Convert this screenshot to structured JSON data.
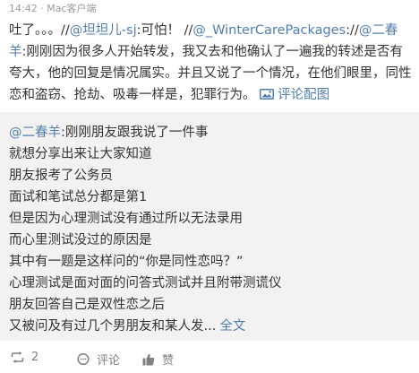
{
  "post": {
    "time": "14:42",
    "separator": " · ",
    "source": "Mac客户端",
    "text_start": "吐了。。。//",
    "mention1": "@坦坦儿-sj",
    "text_mid1": ":可怕！ //",
    "mention2": "@_WinterCarePackages",
    "text_mid2": "://",
    "mention3": "@二春羊",
    "text_mid3": ":刚刚因为很多人开始转发，我又去和他确认了一遍我的转述是否有夸大，他的回复是情况属实。并且又说了一个情况，在他们眼里，同性恋和盗窃、抢劫、吸毒一样是，犯罪行为。",
    "pic_link_label": "评论配图",
    "pic_icon": "image-icon"
  },
  "repost": {
    "author": "@二春羊",
    "first_line_rest": ":刚刚朋友跟我说了一件事",
    "lines": [
      "就想分享出来让大家知道",
      "朋友报考了公务员",
      "面试和笔试总分都是第1",
      "但是因为心理测试没有通过所以无法录用",
      "而心里测试没过的原因是",
      "其中有一题是这样问的“你是同性恋吗？”",
      "心理测试是面对面的问答式测试并且附带测谎仪",
      "朋友回答自己是双性恋之后"
    ],
    "last_line": "又被问及有过几个男朋友和某人发...",
    "full_text_label": "全文"
  },
  "actions": {
    "repost_count": "2",
    "comment_label": "评论",
    "like_label": "赞"
  },
  "colors": {
    "link": "#507daf",
    "repost_bg": "#f2f2f2",
    "meta": "#9a9a9a",
    "action": "#808080"
  }
}
